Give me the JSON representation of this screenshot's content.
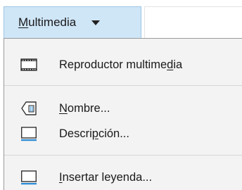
{
  "menubar": {
    "menu_label_pre": "",
    "menu_label_accel": "M",
    "menu_label_post": "ultimedia"
  },
  "dropdown": {
    "items": [
      {
        "icon": "media-player-icon",
        "pre": "Reproductor multime",
        "accel": "d",
        "post": "ia"
      },
      {
        "icon": "name-tag-icon",
        "pre": "",
        "accel": "N",
        "post": "ombre..."
      },
      {
        "icon": "description-icon",
        "pre": "Descri",
        "accel": "p",
        "post": "ción..."
      },
      {
        "icon": "caption-icon",
        "pre": "",
        "accel": "I",
        "post": "nsertar leyenda..."
      }
    ]
  },
  "colors": {
    "menu_highlight": "#cfe6f7",
    "icon_accent": "#2a8ad4"
  }
}
